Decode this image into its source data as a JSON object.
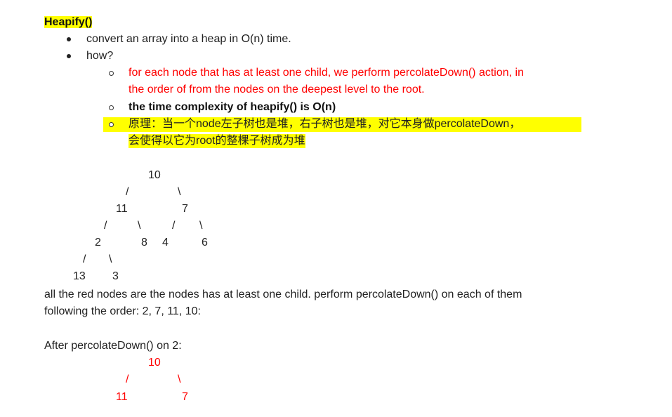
{
  "heading": {
    "title": "Heapify",
    "suffix": "()"
  },
  "bullets": [
    {
      "text": "convert an array into a heap in O(n) time."
    },
    {
      "text": "how?"
    }
  ],
  "sub_bullets": [
    {
      "line1": "for each node that has at least one child, we perform percolateDown() action, in",
      "line2": "the order of from the nodes on the deepest level to the root."
    },
    {
      "line1": "the time complexity of heapify() is O(n)"
    },
    {
      "line1": "原理：当一个node左子树也是堆，右子树也是堆，对它本身做percolateDown，",
      "line2": "会使得以它为root的整棵子树成为堆"
    }
  ],
  "tree1": {
    "n10": "10",
    "n11": "11",
    "n7": "7",
    "n2": "2",
    "n8": "8",
    "n4": "4",
    "n6": "6",
    "n13": "13",
    "n3": "3",
    "slash": "/",
    "backslash": "\\"
  },
  "paragraph": {
    "line1": "all the red nodes are the nodes has at least one child. perform percolateDown() on each of them",
    "line2": "following the order: 2, 7, 11, 10:",
    "after": "After percolateDown() on 2:"
  },
  "tree2": {
    "n10": "10",
    "n11": "11",
    "n7": "7",
    "slash": "/",
    "backslash": "\\"
  },
  "colors": {
    "highlight": "#ffff00",
    "red": "#ff0000"
  }
}
